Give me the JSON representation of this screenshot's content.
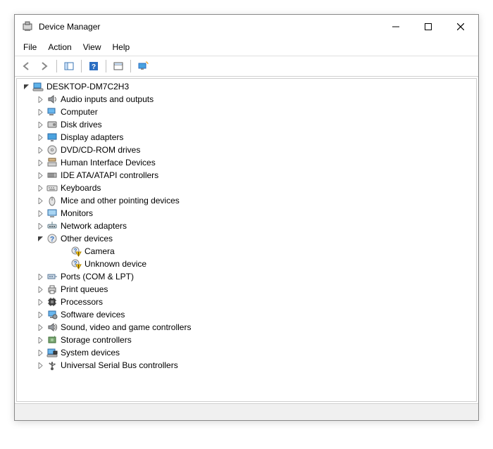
{
  "window": {
    "title": "Device Manager"
  },
  "menu": {
    "file": "File",
    "action": "Action",
    "view": "View",
    "help": "Help"
  },
  "tree": {
    "root": "DESKTOP-DM7C2H3",
    "categories": [
      {
        "label": "Audio inputs and outputs",
        "icon": "speaker",
        "expanded": false
      },
      {
        "label": "Computer",
        "icon": "computer",
        "expanded": false
      },
      {
        "label": "Disk drives",
        "icon": "disk",
        "expanded": false
      },
      {
        "label": "Display adapters",
        "icon": "display",
        "expanded": false
      },
      {
        "label": "DVD/CD-ROM drives",
        "icon": "dvd",
        "expanded": false
      },
      {
        "label": "Human Interface Devices",
        "icon": "hid",
        "expanded": false
      },
      {
        "label": "IDE ATA/ATAPI controllers",
        "icon": "ide",
        "expanded": false
      },
      {
        "label": "Keyboards",
        "icon": "keyboard",
        "expanded": false
      },
      {
        "label": "Mice and other pointing devices",
        "icon": "mouse",
        "expanded": false
      },
      {
        "label": "Monitors",
        "icon": "monitor",
        "expanded": false
      },
      {
        "label": "Network adapters",
        "icon": "network",
        "expanded": false
      },
      {
        "label": "Other devices",
        "icon": "unknown",
        "expanded": true,
        "children": [
          {
            "label": "Camera",
            "icon": "warning"
          },
          {
            "label": "Unknown device",
            "icon": "warning"
          }
        ]
      },
      {
        "label": "Ports (COM & LPT)",
        "icon": "port",
        "expanded": false
      },
      {
        "label": "Print queues",
        "icon": "printer",
        "expanded": false
      },
      {
        "label": "Processors",
        "icon": "cpu",
        "expanded": false
      },
      {
        "label": "Software devices",
        "icon": "software",
        "expanded": false
      },
      {
        "label": "Sound, video and game controllers",
        "icon": "sound",
        "expanded": false
      },
      {
        "label": "Storage controllers",
        "icon": "storage",
        "expanded": false
      },
      {
        "label": "System devices",
        "icon": "system",
        "expanded": false
      },
      {
        "label": "Universal Serial Bus controllers",
        "icon": "usb",
        "expanded": false
      }
    ]
  }
}
